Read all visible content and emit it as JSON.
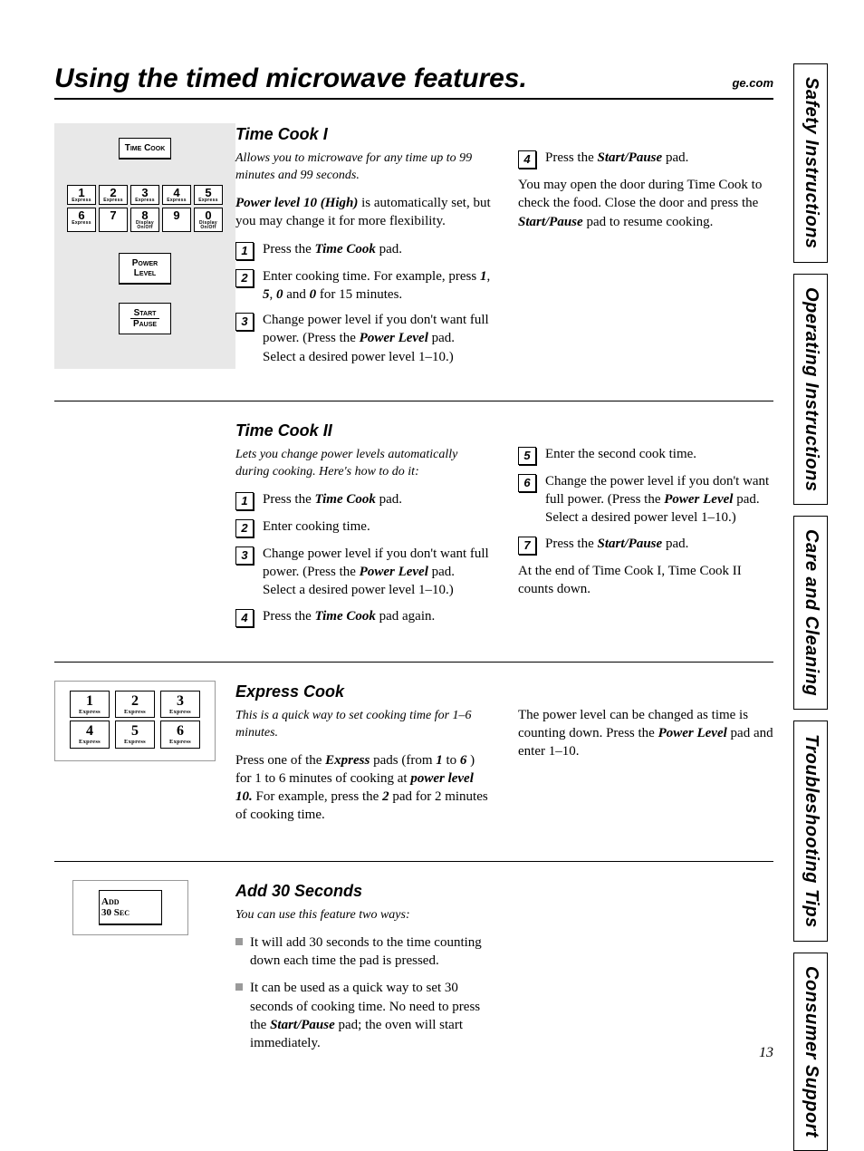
{
  "header": {
    "title": "Using the timed microwave features.",
    "url": "ge.com"
  },
  "side_tabs": [
    "Safety Instructions",
    "Operating Instructions",
    "Care and Cleaning",
    "Troubleshooting Tips",
    "Consumer Support"
  ],
  "page_number": "13",
  "panel1": {
    "time_cook": "Time Cook",
    "power_level": "Power Level",
    "start_pause_line1": "Start",
    "start_pause_line2": "Pause",
    "row1": [
      {
        "n": "1",
        "sub": "Express"
      },
      {
        "n": "2",
        "sub": "Express"
      },
      {
        "n": "3",
        "sub": "Express"
      },
      {
        "n": "4",
        "sub": "Express"
      },
      {
        "n": "5",
        "sub": "Express"
      }
    ],
    "row2": [
      {
        "n": "6",
        "sub": "Express"
      },
      {
        "n": "7",
        "sub": ""
      },
      {
        "n": "8",
        "sub": "Display On/Off"
      },
      {
        "n": "9",
        "sub": ""
      },
      {
        "n": "0",
        "sub": "Display On/Off"
      }
    ]
  },
  "panel2": {
    "row1": [
      {
        "n": "1",
        "sub": "Express"
      },
      {
        "n": "2",
        "sub": "Express"
      },
      {
        "n": "3",
        "sub": "Express"
      }
    ],
    "row2": [
      {
        "n": "4",
        "sub": "Express"
      },
      {
        "n": "5",
        "sub": "Express"
      },
      {
        "n": "6",
        "sub": "Express"
      }
    ]
  },
  "panel3": {
    "add30_line1": "Add",
    "add30_line2": "30 Sec"
  },
  "tc1": {
    "h": "Time Cook I",
    "lede": "Allows you to microwave for any time up to 99 minutes and 99 seconds.",
    "power_intro_1": "Power level 10 (High)",
    "power_intro_2": " is automatically set, but you may change it for more flexibility.",
    "s1a": "Press the ",
    "s1b": "Time Cook",
    "s1c": " pad.",
    "s2a": "Enter cooking time. For example, press ",
    "s2_1": "1",
    "s2_c1": ", ",
    "s2_5": "5",
    "s2_c2": ", ",
    "s2_0": "0",
    "s2_and": " and ",
    "s2_0b": "0",
    "s2_end": " for 15 minutes.",
    "s3a": "Change power level if you don't want full power. (Press the ",
    "s3b": "Power Level",
    "s3c": " pad. Select a desired power level 1–10.)",
    "s4a": "Press the ",
    "s4b": "Start/Pause",
    "s4c": " pad.",
    "note1": "You may open the door during Time Cook to check the food. Close the door and press the ",
    "note1b": "Start/Pause",
    "note1c": " pad to resume cooking."
  },
  "tc2": {
    "h": "Time Cook II",
    "lede": "Lets you change power levels automatically during cooking. Here's how to do it:",
    "s1a": "Press the ",
    "s1b": "Time Cook",
    "s1c": " pad.",
    "s2": "Enter cooking time.",
    "s3a": "Change power level if you don't want full power. (Press the ",
    "s3b": "Power Level",
    "s3c": " pad. Select a desired power level 1–10.)",
    "s4a": "Press the ",
    "s4b": "Time Cook",
    "s4c": " pad again.",
    "s5": "Enter the second cook time.",
    "s6a": "Change the power level if you don't want full power. (Press the ",
    "s6b": "Power Level",
    "s6c": " pad. Select a desired power level 1–10.)",
    "s7a": "Press the ",
    "s7b": "Start/Pause",
    "s7c": " pad.",
    "note": "At the end of Time Cook I, Time Cook II counts down."
  },
  "ec": {
    "h": "Express Cook",
    "lede": "This is a quick way to set cooking time for 1–6 minutes.",
    "p1a": "Press one of the ",
    "p1b": "Express",
    "p1c": " pads (from ",
    "p1d": "1",
    "p1e": " to ",
    "p1f": "6",
    "p1g": " ) for 1 to 6 minutes of cooking at ",
    "p1h": "power level 10.",
    "p1i": " For example, press the ",
    "p1j": "2",
    "p1k": " pad for 2 minutes of cooking time.",
    "p2a": "The power level can be changed as time is counting down. Press the ",
    "p2b": "Power Level",
    "p2c": " pad and enter 1–10."
  },
  "a30": {
    "h": "Add 30 Seconds",
    "lede": "You can use this feature two ways:",
    "b1": "It will add 30 seconds to the time counting down each time the pad is pressed.",
    "b2a": "It can be used as a quick way to set 30 seconds of cooking time. No need to press the ",
    "b2b": "Start/Pause",
    "b2c": " pad; the oven will start immediately."
  },
  "nums": {
    "1": "1",
    "2": "2",
    "3": "3",
    "4": "4",
    "5": "5",
    "6": "6",
    "7": "7"
  }
}
